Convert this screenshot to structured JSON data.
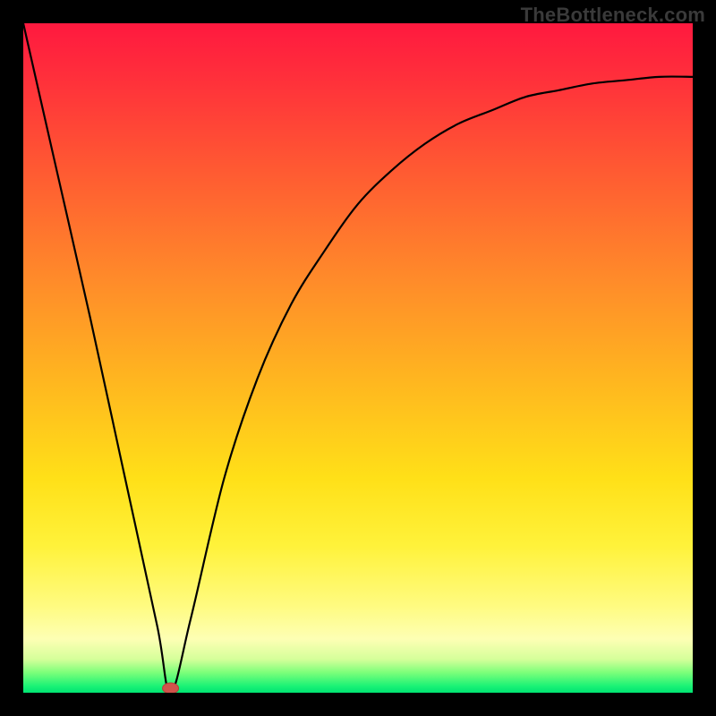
{
  "watermark": "TheBottleneck.com",
  "chart_data": {
    "type": "line",
    "title": "",
    "xlabel": "",
    "ylabel": "",
    "xlim": [
      0,
      100
    ],
    "ylim": [
      0,
      100
    ],
    "grid": false,
    "legend": false,
    "background_gradient": {
      "direction": "vertical",
      "stops": [
        {
          "pos": 0,
          "color": "#ff193f"
        },
        {
          "pos": 22,
          "color": "#ff5a32"
        },
        {
          "pos": 54,
          "color": "#ffb81f"
        },
        {
          "pos": 78,
          "color": "#fff23a"
        },
        {
          "pos": 92,
          "color": "#fdffb4"
        },
        {
          "pos": 100,
          "color": "#00e472"
        }
      ]
    },
    "series": [
      {
        "name": "bottleneck-curve",
        "x": [
          0,
          5,
          10,
          15,
          20,
          22,
          25,
          30,
          35,
          40,
          45,
          50,
          55,
          60,
          65,
          70,
          75,
          80,
          85,
          90,
          95,
          100
        ],
        "y": [
          100,
          78,
          56,
          33,
          10,
          0,
          11,
          32,
          47,
          58,
          66,
          73,
          78,
          82,
          85,
          87,
          89,
          90,
          91,
          91.5,
          92,
          92
        ]
      }
    ],
    "marker": {
      "name": "optimal-point",
      "x": 22,
      "y": 0,
      "shape": "pill",
      "color": "#d1534b"
    }
  }
}
